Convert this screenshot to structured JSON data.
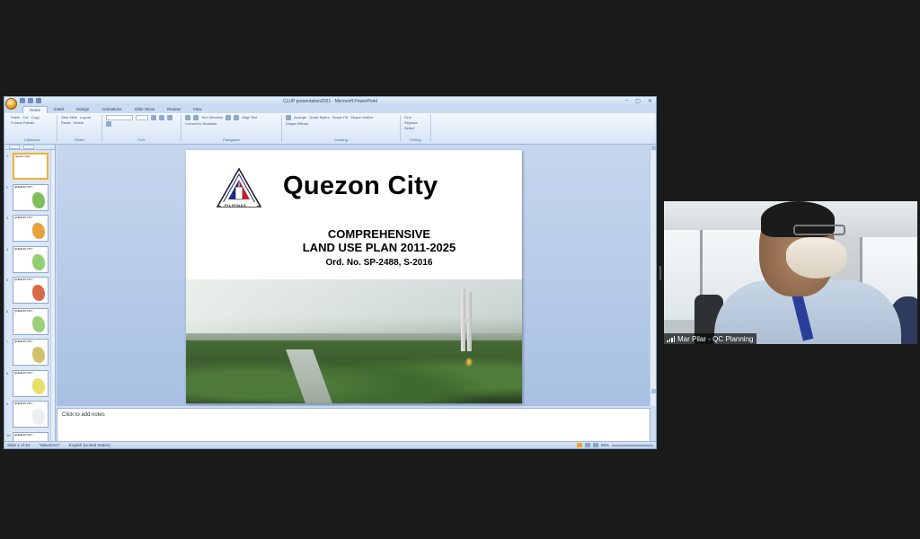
{
  "window": {
    "title": "CLUP presentation2021 - Microsoft PowerPoint",
    "controls": [
      "–",
      "▢",
      "✕"
    ]
  },
  "ribbon": {
    "tabs": [
      "Home",
      "Insert",
      "Design",
      "Animations",
      "Slide Show",
      "Review",
      "View"
    ],
    "active_tab": "Home",
    "groups": [
      {
        "name": "Clipboard",
        "items": [
          "Cut",
          "Copy",
          "Format Painter",
          "Paste"
        ]
      },
      {
        "name": "Slides",
        "items": [
          "Layout",
          "Reset",
          "Delete",
          "New Slide"
        ]
      },
      {
        "name": "Font",
        "items": []
      },
      {
        "name": "Paragraph",
        "items": [
          "Text Direction",
          "Align Text",
          "Convert to SmartArt"
        ]
      },
      {
        "name": "Drawing",
        "items": [
          "Arrange",
          "Quick Styles",
          "Shape Fill",
          "Shape Outline",
          "Shape Effects"
        ]
      },
      {
        "name": "Editing",
        "items": [
          "Find",
          "Replace",
          "Select"
        ]
      }
    ]
  },
  "thumbnails": {
    "numbers": [
      "1",
      "2",
      "3",
      "4",
      "5",
      "6",
      "7",
      "8",
      "9",
      "10"
    ],
    "first_title": "Quezon City",
    "others_title": "QUEZON CITY"
  },
  "slide": {
    "title": "Quezon City",
    "line1": "COMPREHENSIVE",
    "line2": "LAND USE PLAN 2011-2025",
    "line3": "Ord. No. SP-2488, S-2016",
    "seal_text": "PILIPINAS"
  },
  "notes": {
    "placeholder": "Click to add notes"
  },
  "status": {
    "slide": "Slide 1 of 34",
    "theme": "\"Waveform\"",
    "language": "English (United States)",
    "zoom": "55%"
  },
  "participant": {
    "name": "Mar Pilar - QC Planning"
  }
}
